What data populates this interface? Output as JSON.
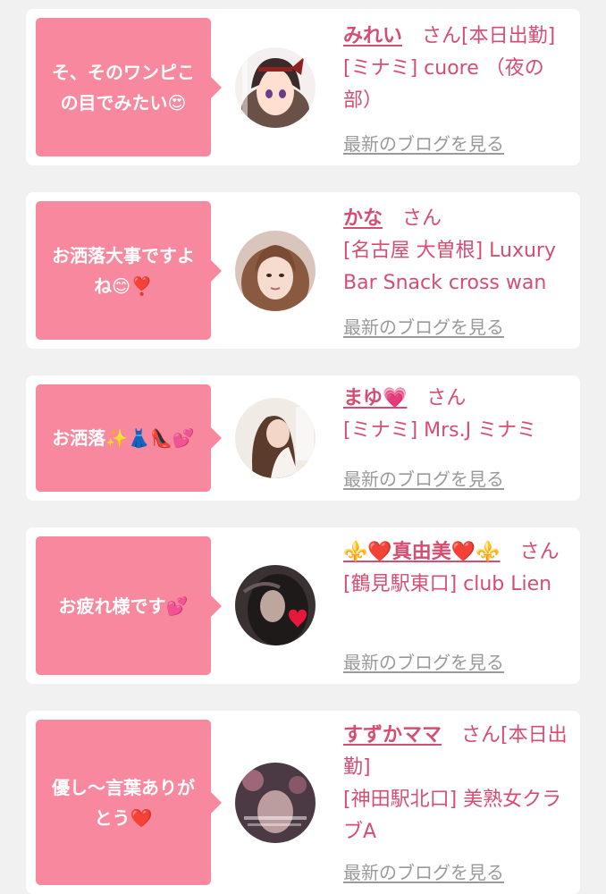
{
  "cards": [
    {
      "message": "そ、そのワンピこの目でみたい😍",
      "name": "みれい",
      "suffix": "さん[本日出勤]",
      "shop": "[ミナミ] cuore （夜の部）",
      "blog_link": "最新のブログを見る"
    },
    {
      "message": "お洒落大事ですよね😊❣️",
      "name": "かな",
      "suffix": "さん",
      "shop": "[名古屋 大曽根] Luxury Bar Snack cross wan",
      "blog_link": "最新のブログを見る"
    },
    {
      "message": "お洒落✨👗👠💕",
      "name": "まゆ💗",
      "suffix": "さん",
      "shop": "[ミナミ] Mrs.J ミナミ",
      "blog_link": "最新のブログを見る"
    },
    {
      "message": "お疲れ様です💕",
      "name": "⚜️❤️真由美❤️⚜️",
      "suffix": "さん",
      "shop": "[鶴見駅東口] club Lien",
      "blog_link": "最新のブログを見る"
    },
    {
      "message": "優し〜言葉ありがとう❤️",
      "name": "すずかママ",
      "suffix": "さん[本日出勤]",
      "shop": "[神田駅北口] 美熟女クラブA",
      "blog_link": "最新のブログを見る"
    }
  ]
}
